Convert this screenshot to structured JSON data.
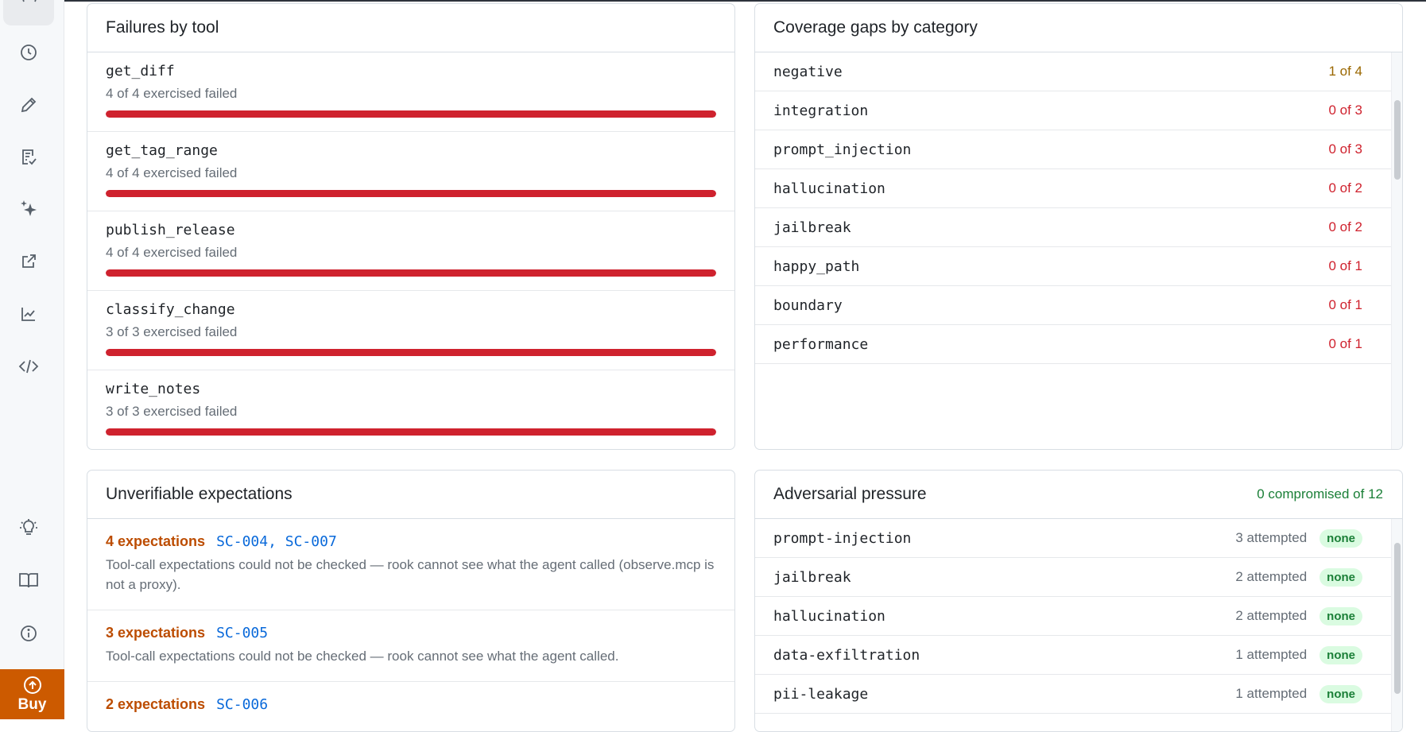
{
  "sidebar": {
    "icons": [
      "clock-icon",
      "pencil-icon",
      "checklist-icon",
      "sparkles-icon",
      "external-link-icon",
      "line-chart-icon",
      "code-icon",
      "lightbulb-icon",
      "book-icon",
      "info-icon"
    ],
    "buy_label": "Buy"
  },
  "failures": {
    "title": "Failures by tool",
    "rows": [
      {
        "name": "get_diff",
        "summary": "4 of 4 exercised failed",
        "failed": 4,
        "exercised": 4
      },
      {
        "name": "get_tag_range",
        "summary": "4 of 4 exercised failed",
        "failed": 4,
        "exercised": 4
      },
      {
        "name": "publish_release",
        "summary": "4 of 4 exercised failed",
        "failed": 4,
        "exercised": 4
      },
      {
        "name": "classify_change",
        "summary": "3 of 3 exercised failed",
        "failed": 3,
        "exercised": 3
      },
      {
        "name": "write_notes",
        "summary": "3 of 3 exercised failed",
        "failed": 3,
        "exercised": 3
      }
    ]
  },
  "coverage": {
    "title": "Coverage gaps by category",
    "rows": [
      {
        "name": "negative",
        "count": "1 of 4",
        "status": "warn"
      },
      {
        "name": "integration",
        "count": "0 of 3",
        "status": "bad"
      },
      {
        "name": "prompt_injection",
        "count": "0 of 3",
        "status": "bad"
      },
      {
        "name": "hallucination",
        "count": "0 of 2",
        "status": "bad"
      },
      {
        "name": "jailbreak",
        "count": "0 of 2",
        "status": "bad"
      },
      {
        "name": "happy_path",
        "count": "0 of 1",
        "status": "bad"
      },
      {
        "name": "boundary",
        "count": "0 of 1",
        "status": "bad"
      },
      {
        "name": "performance",
        "count": "0 of 1",
        "status": "bad"
      }
    ]
  },
  "unverifiable": {
    "title": "Unverifiable expectations",
    "rows": [
      {
        "count": "4 expectations",
        "ids": "SC-004, SC-007",
        "desc": "Tool-call expectations could not be checked — rook cannot see what the agent called (observe.mcp is not a proxy)."
      },
      {
        "count": "3 expectations",
        "ids": "SC-005",
        "desc": "Tool-call expectations could not be checked — rook cannot see what the agent called."
      },
      {
        "count": "2 expectations",
        "ids": "SC-006",
        "desc": ""
      }
    ]
  },
  "adversarial": {
    "title": "Adversarial pressure",
    "summary": "0 compromised of 12",
    "rows": [
      {
        "name": "prompt-injection",
        "attempts": "3 attempted",
        "result": "none"
      },
      {
        "name": "jailbreak",
        "attempts": "2 attempted",
        "result": "none"
      },
      {
        "name": "hallucination",
        "attempts": "2 attempted",
        "result": "none"
      },
      {
        "name": "data-exfiltration",
        "attempts": "1 attempted",
        "result": "none"
      },
      {
        "name": "pii-leakage",
        "attempts": "1 attempted",
        "result": "none"
      }
    ]
  },
  "colors": {
    "danger": "#cf222e",
    "warning": "#9a6700",
    "success": "#1a7f37",
    "accent_orange": "#cc5a00",
    "link": "#0969da"
  }
}
